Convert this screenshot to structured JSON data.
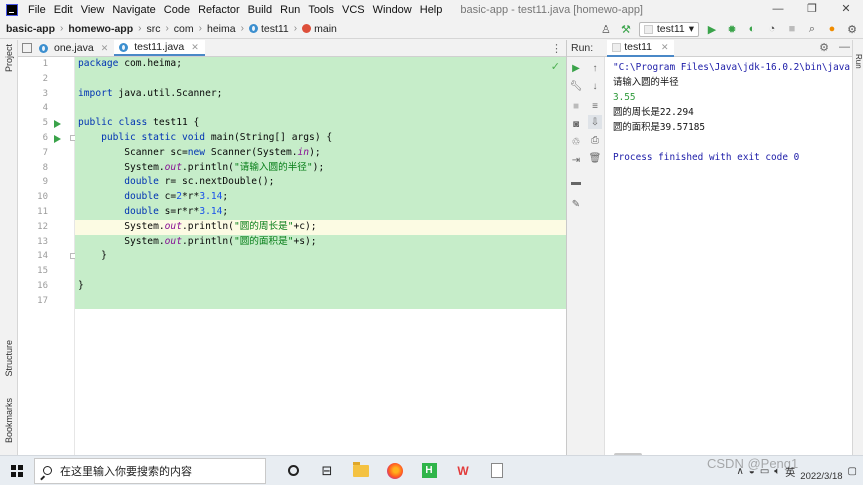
{
  "menubar": {
    "items": [
      "File",
      "Edit",
      "View",
      "Navigate",
      "Code",
      "Refactor",
      "Build",
      "Run",
      "Tools",
      "VCS",
      "Window",
      "Help"
    ],
    "title": "basic-app - test11.java [homewo-app]",
    "controls": [
      "—",
      "❐",
      "✕"
    ]
  },
  "breadcrumb": {
    "project": "basic-app",
    "module": "homewo-app",
    "src": "src",
    "pkg1": "com",
    "pkg2": "heima",
    "cls": "test11",
    "method": "main"
  },
  "toolbar": {
    "run_config": "test11"
  },
  "left_strip": {
    "project": "Project",
    "structure": "Structure",
    "bookmarks": "Bookmarks"
  },
  "editor_tabs": [
    {
      "label": "one.java"
    },
    {
      "label": "test11.java"
    }
  ],
  "code": {
    "line_numbers": [
      "1",
      "2",
      "3",
      "4",
      "5",
      "6",
      "7",
      "8",
      "9",
      "10",
      "11",
      "12",
      "13",
      "14",
      "15",
      "16",
      "17"
    ],
    "lines": [
      "package com.heima;",
      "",
      "import java.util.Scanner;",
      "",
      "public class test11 {",
      "    public static void main(String[] args) {",
      "        Scanner sc=new Scanner(System.in);",
      "        System.out.println(\"请输入圆的半径\");",
      "        double r= sc.nextDouble();",
      "        double c=2*r*3.14;",
      "        double s=r*r*3.14;",
      "        System.out.println(\"圆的周长是\"+c);",
      "        System.out.println(\"圆的面积是\"+s);",
      "    }",
      "",
      "}",
      ""
    ]
  },
  "run_panel": {
    "label": "Run:",
    "tab": "test11",
    "right_strip_label": "Run",
    "console": [
      {
        "kind": "cmd",
        "text": "\"C:\\Program Files\\Java\\jdk-16.0.2\\bin\\java.exe\""
      },
      {
        "kind": "out",
        "text": "请输入圆的半径"
      },
      {
        "kind": "input",
        "text": "3.55"
      },
      {
        "kind": "out",
        "text": "圆的周长是22.294"
      },
      {
        "kind": "out",
        "text": "圆的面积是39.57185"
      },
      {
        "kind": "out",
        "text": ""
      },
      {
        "kind": "done",
        "text": "Process finished with exit code 0"
      }
    ]
  },
  "taskbar": {
    "search_placeholder": "在这里输入你要搜索的内容",
    "ime": "英",
    "date": "2022/3/18"
  },
  "watermark": "CSDN @Peng1",
  "colors": {
    "highlight": "#c6edc9",
    "current_line": "#fcfbe3",
    "keyword": "#0033b3",
    "string": "#067d17",
    "number": "#1750eb",
    "static_italic": "#871094",
    "console_cmd": "#1c1ca8",
    "console_input": "#2e9a3a"
  }
}
